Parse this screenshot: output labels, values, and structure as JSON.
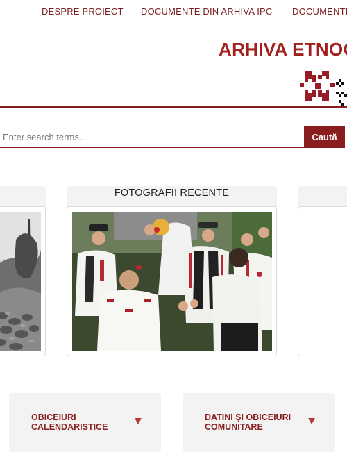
{
  "nav": {
    "items": [
      "DESPRE PROIECT",
      "DOCUMENTE DIN ARHIVA IPC",
      "DOCUMENTE"
    ]
  },
  "brand": {
    "title": "ARHIVA ETNOG",
    "logo_icon": "cross-stitch-ornament-icon",
    "color": "#a0201e"
  },
  "search": {
    "placeholder": "Enter search terms...",
    "button_label": "Caută"
  },
  "photos": {
    "center_heading": "FOTOGRAFII RECENTE"
  },
  "categories": [
    {
      "label": "OBICEIURI CALENDARISTICE",
      "icon": "caret-down-icon"
    },
    {
      "label": "DATINI ȘI OBICEIURI COMUNITARE",
      "icon": "caret-down-icon"
    }
  ],
  "colors": {
    "accent": "#8a1e1e",
    "panel": "#f3f3f3"
  }
}
